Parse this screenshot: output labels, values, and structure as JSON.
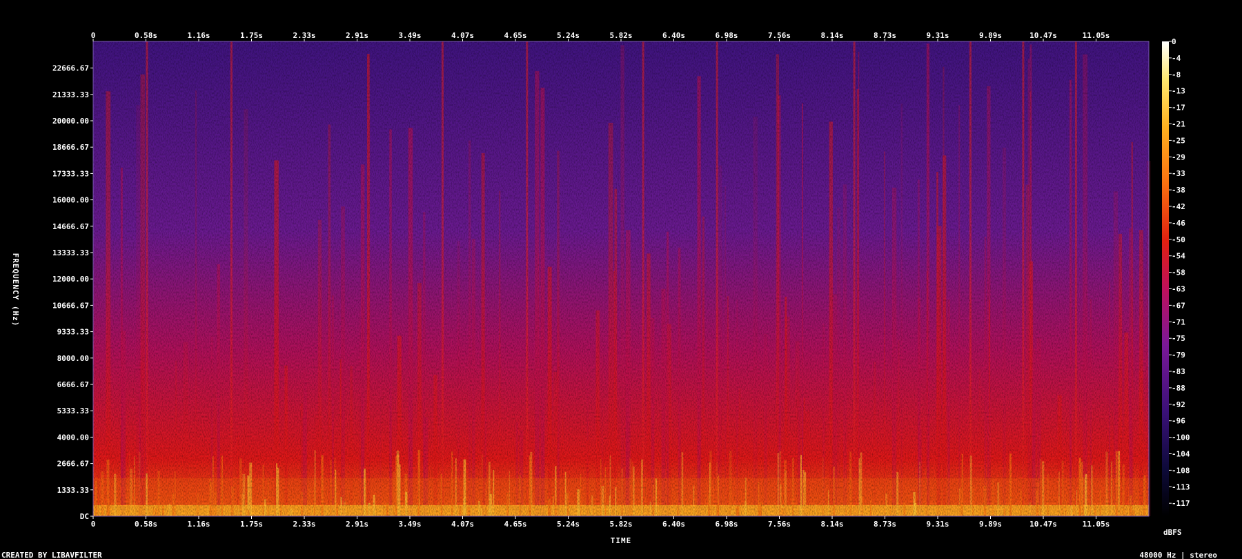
{
  "chart_data": {
    "type": "heatmap",
    "title": "",
    "xlabel": "TIME",
    "ylabel": "FREQUENCY (Hz)",
    "colorbar_label": "dBFS",
    "x_ticks": [
      "0",
      "0.58s",
      "1.16s",
      "1.75s",
      "2.33s",
      "2.91s",
      "3.49s",
      "4.07s",
      "4.65s",
      "5.24s",
      "5.82s",
      "6.40s",
      "6.98s",
      "7.56s",
      "8.14s",
      "8.73s",
      "9.31s",
      "9.89s",
      "10.47s",
      "11.05s"
    ],
    "y_ticks": [
      "22666.67",
      "21333.33",
      "20000.00",
      "18666.67",
      "17333.33",
      "16000.00",
      "14666.67",
      "13333.33",
      "12000.00",
      "10666.67",
      "9333.33",
      "8000.00",
      "6666.67",
      "5333.33",
      "4000.00",
      "2666.67",
      "1333.33",
      "DC"
    ],
    "colorbar_ticks": [
      "0",
      "-4",
      "-8",
      "-13",
      "-17",
      "-21",
      "-25",
      "-29",
      "-33",
      "-38",
      "-42",
      "-46",
      "-50",
      "-54",
      "-58",
      "-63",
      "-67",
      "-71",
      "-75",
      "-79",
      "-83",
      "-88",
      "-92",
      "-96",
      "-100",
      "-104",
      "-108",
      "-113",
      "-117"
    ],
    "footer_left": "CREATED BY LIBAVFILTER",
    "footer_right": "48000 Hz | stereo",
    "colors": [
      "#000000",
      "#0d0a3a",
      "#3a1078",
      "#6a1a98",
      "#a0107a",
      "#d0102a",
      "#f03010",
      "#fa7010",
      "#ffb020",
      "#ffe870",
      "#ffffff"
    ]
  }
}
